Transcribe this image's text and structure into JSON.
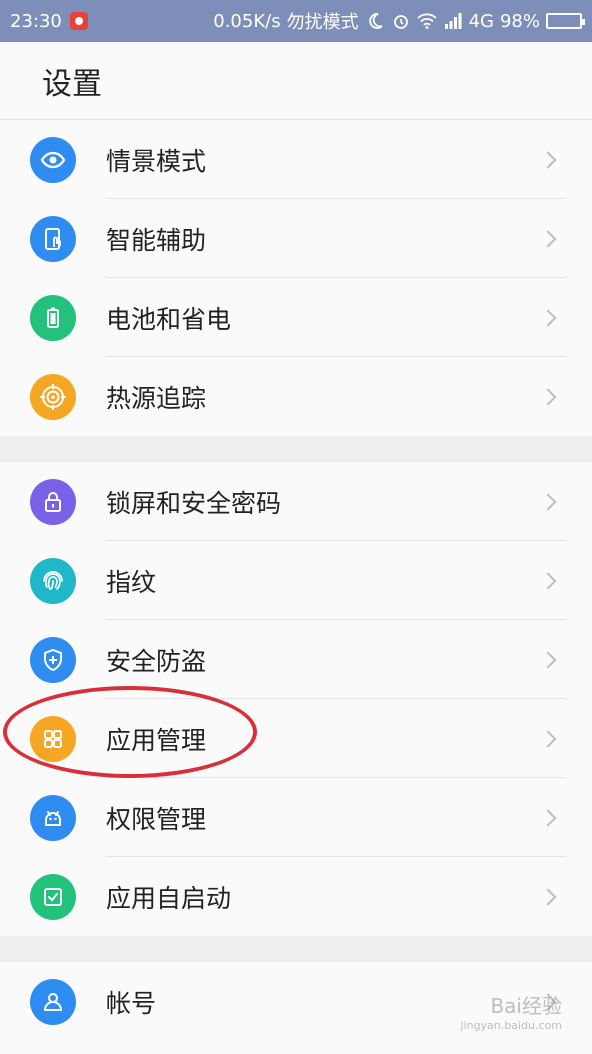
{
  "status_bar": {
    "time": "23:30",
    "net_speed": "0.05K/s",
    "dnd_mode": "勿扰模式",
    "network": "4G",
    "battery": "98%"
  },
  "header": {
    "title": "设置"
  },
  "groups": [
    {
      "items": [
        {
          "label": "情景模式",
          "icon": "eye-icon",
          "color": "#2f8cf0"
        },
        {
          "label": "智能辅助",
          "icon": "touch-phone-icon",
          "color": "#2f8cf0"
        },
        {
          "label": "电池和省电",
          "icon": "battery-icon",
          "color": "#22c17c"
        },
        {
          "label": "热源追踪",
          "icon": "target-icon",
          "color": "#f5a623"
        }
      ]
    },
    {
      "items": [
        {
          "label": "锁屏和安全密码",
          "icon": "lock-icon",
          "color": "#7a62e8"
        },
        {
          "label": "指纹",
          "icon": "fingerprint-icon",
          "color": "#20b7c8"
        },
        {
          "label": "安全防盗",
          "icon": "shield-icon",
          "color": "#2f8cf0"
        },
        {
          "label": "应用管理",
          "icon": "apps-grid-icon",
          "color": "#f5a623"
        },
        {
          "label": "权限管理",
          "icon": "android-icon",
          "color": "#2f8cf0"
        },
        {
          "label": "应用自启动",
          "icon": "checkbox-icon",
          "color": "#22c17c"
        }
      ]
    },
    {
      "items": [
        {
          "label": "帐号",
          "icon": "person-icon",
          "color": "#2f8cf0"
        }
      ]
    }
  ],
  "watermark": {
    "text": "Bai经验",
    "sub": "jingyan.baidu.com"
  }
}
